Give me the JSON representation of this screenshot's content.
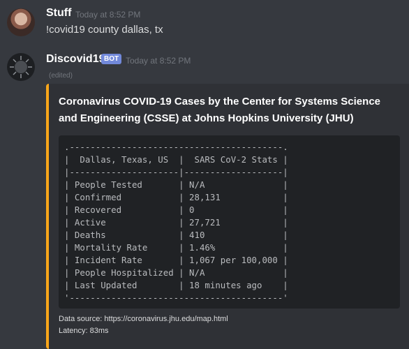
{
  "messages": [
    {
      "username": "Stuff",
      "timestamp": "Today at 8:52 PM",
      "content": "!covid19 county dallas, tx"
    },
    {
      "username": "Discovid19",
      "badge": "BOT",
      "timestamp": "Today at 8:52 PM",
      "edited": "(edited)"
    }
  ],
  "embed": {
    "accent_color": "#faa61a",
    "title": "Coronavirus COVID-19 Cases by the Center for Systems Science and Engineering (CSSE) at Johns Hopkins University (JHU)",
    "table": {
      "location": "Dallas, Texas, US",
      "header": "SARS CoV-2 Stats",
      "rows": [
        {
          "label": "People Tested",
          "value": "N/A"
        },
        {
          "label": "Confirmed",
          "value": "28,131"
        },
        {
          "label": "Recovered",
          "value": "0"
        },
        {
          "label": "Active",
          "value": "27,721"
        },
        {
          "label": "Deaths",
          "value": "410"
        },
        {
          "label": "Mortality Rate",
          "value": "1.46%"
        },
        {
          "label": "Incident Rate",
          "value": "1,067 per 100,000"
        },
        {
          "label": "People Hospitalized",
          "value": "N/A"
        },
        {
          "label": "Last Updated",
          "value": "18 minutes ago"
        }
      ]
    },
    "footer": {
      "source": "Data source: https://coronavirus.jhu.edu/map.html",
      "latency": "Latency: 83ms"
    }
  }
}
